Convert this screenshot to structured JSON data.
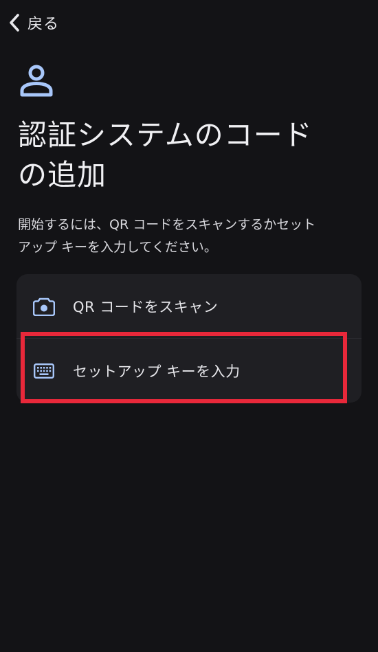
{
  "header": {
    "back_label": "戻る",
    "back_icon": "chevron-left-icon"
  },
  "main": {
    "header_icon": "person-icon",
    "title_line1": "認証システムのコード",
    "title_line2": "の追加",
    "description_line1": "開始するには、QR コードをスキャンするかセット",
    "description_line2": "アップ キーを入力してください。"
  },
  "options": [
    {
      "icon": "camera-icon",
      "label": "QR コードをスキャン"
    },
    {
      "icon": "keyboard-icon",
      "label": "セットアップ キーを入力"
    }
  ],
  "colors": {
    "background": "#131316",
    "card": "#1f1f23",
    "accent_icon": "#a8c7fa",
    "highlight": "#e8283a",
    "text": "#e6e6ea"
  }
}
